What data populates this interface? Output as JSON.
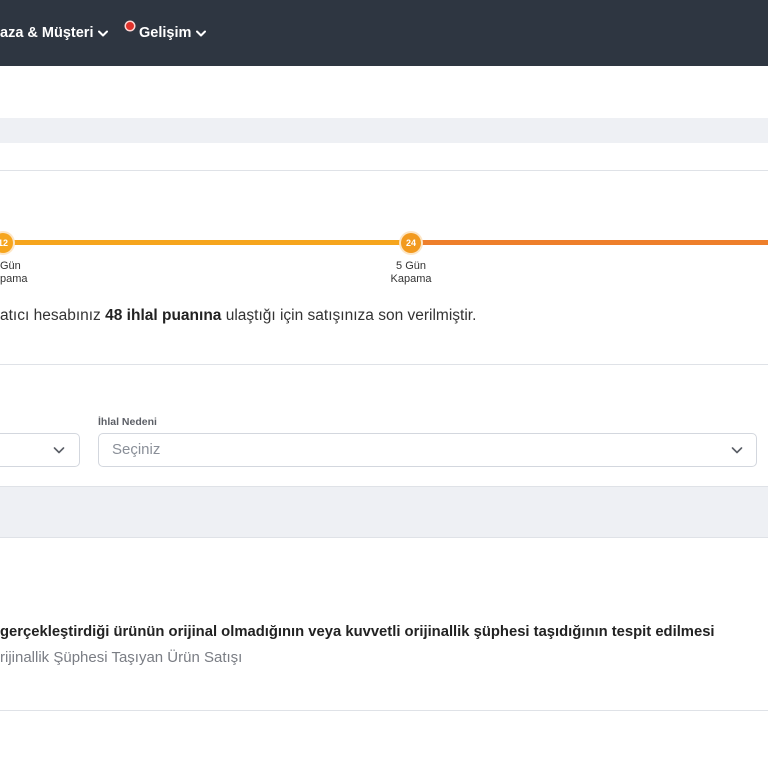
{
  "nav": {
    "items": [
      {
        "label": "aza & Müşteri",
        "icon": "chevron-down-icon"
      },
      {
        "label": "Gelişim",
        "icon": "chevron-down-icon",
        "notification_dot": true
      }
    ]
  },
  "penalty_progress": {
    "steps": [
      {
        "points": "12",
        "label_line1": "Gün",
        "label_line2": "pama"
      },
      {
        "points": "24",
        "label_line1": "5 Gün",
        "label_line2": "Kapama"
      }
    ],
    "message": {
      "prefix": "atıcı hesabınız ",
      "highlight": "48 ihlal puanına",
      "suffix": " ulaştığı için satışınıza son verilmiştir."
    }
  },
  "filters": {
    "previous_filter": {
      "icon": "chevron-down-icon"
    },
    "violation_reason": {
      "label": "İhlal Nedeni",
      "placeholder": "Seçiniz",
      "icon": "chevron-down-icon"
    }
  },
  "violation_row": {
    "description": "gerçekleştirdiği ürünün orijinal olmadığının veya kuvvetli orijinallik şüphesi taşıdığının tespit edilmesi",
    "reason": "rijinallik Şüphesi Taşıyan Ürün Satışı"
  },
  "colors": {
    "nav_background": "#2e3641",
    "notification_dot": "#e0322b",
    "progress_first": "#f6a51d",
    "progress_second": "#ee7f2b",
    "step_circle_first": "#f6a51d",
    "step_circle_second": "#f29a1f",
    "band_background": "#eef0f4"
  }
}
